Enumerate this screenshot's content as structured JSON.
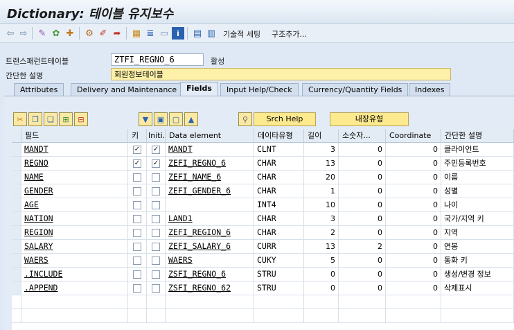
{
  "title": "Dictionary: 테이블 유지보수",
  "toolbar": {
    "tech_settings_label": "기술적 세팅",
    "append_structure_label": "구조추가..."
  },
  "header": {
    "table_label": "트랜스패런트테이블",
    "table_name": "ZTFI_REGNO_6",
    "status": "활성",
    "short_desc_label": "간단한 설명",
    "short_desc": "회원정보테이블"
  },
  "tabs": [
    {
      "label": "Attributes",
      "active": false
    },
    {
      "label": "Delivery and Maintenance",
      "active": false
    },
    {
      "label": "Fields",
      "active": true
    },
    {
      "label": "Input Help/Check",
      "active": false
    },
    {
      "label": "Currency/Quantity Fields",
      "active": false
    },
    {
      "label": "Indexes",
      "active": false
    }
  ],
  "table_toolbar": {
    "search_help_label": "Srch Help",
    "builtin_type_label": "내장유형"
  },
  "columns": {
    "field": "필드",
    "key": "키",
    "initial": "Initi...",
    "data_element": "Data element",
    "data_type": "데이타유형",
    "length": "길이",
    "decimals": "소숫자...",
    "coordinate": "Coordinate",
    "short_desc": "간단한 설명"
  },
  "rows": [
    {
      "field": "MANDT",
      "key": true,
      "initial": true,
      "data_element": "MANDT",
      "data_type": "CLNT",
      "length": "3",
      "decimals": "0",
      "coordinate": "0",
      "desc": "클라이언트"
    },
    {
      "field": "REGNO",
      "key": true,
      "initial": true,
      "data_element": "ZEFI_REGNO_6",
      "data_type": "CHAR",
      "length": "13",
      "decimals": "0",
      "coordinate": "0",
      "desc": "주민등록번호"
    },
    {
      "field": "NAME",
      "key": false,
      "initial": false,
      "data_element": "ZEFI_NAME_6",
      "data_type": "CHAR",
      "length": "20",
      "decimals": "0",
      "coordinate": "0",
      "desc": "이름"
    },
    {
      "field": "GENDER",
      "key": false,
      "initial": false,
      "data_element": "ZEFI_GENDER_6",
      "data_type": "CHAR",
      "length": "1",
      "decimals": "0",
      "coordinate": "0",
      "desc": "성별"
    },
    {
      "field": "AGE",
      "key": false,
      "initial": false,
      "data_element": "",
      "data_type": "INT4",
      "length": "10",
      "decimals": "0",
      "coordinate": "0",
      "desc": "나이"
    },
    {
      "field": "NATION",
      "key": false,
      "initial": false,
      "data_element": "LAND1",
      "data_type": "CHAR",
      "length": "3",
      "decimals": "0",
      "coordinate": "0",
      "desc": "국가/지역 키"
    },
    {
      "field": "REGION",
      "key": false,
      "initial": false,
      "data_element": "ZEFI_REGION_6",
      "data_type": "CHAR",
      "length": "2",
      "decimals": "0",
      "coordinate": "0",
      "desc": "지역"
    },
    {
      "field": "SALARY",
      "key": false,
      "initial": false,
      "data_element": "ZEFI_SALARY_6",
      "data_type": "CURR",
      "length": "13",
      "decimals": "2",
      "coordinate": "0",
      "desc": "연봉"
    },
    {
      "field": "WAERS",
      "key": false,
      "initial": false,
      "data_element": "WAERS",
      "data_type": "CUKY",
      "length": "5",
      "decimals": "0",
      "coordinate": "0",
      "desc": "통화 키"
    },
    {
      "field": ".INCLUDE",
      "key": false,
      "initial": false,
      "data_element": "ZSFI_REGNO_6",
      "data_type": "STRU",
      "length": "0",
      "decimals": "0",
      "coordinate": "0",
      "desc": "생성/변경 정보"
    },
    {
      "field": ".APPEND",
      "key": false,
      "initial": false,
      "data_element": "ZSFI_REGNO_62",
      "data_type": "STRU",
      "length": "0",
      "decimals": "0",
      "coordinate": "0",
      "desc": "삭제표시"
    }
  ],
  "colors": {
    "accent_yellow": "#fde98e",
    "header_bg": "#e3ebf4",
    "panel_bg": "#e2ebf6"
  }
}
